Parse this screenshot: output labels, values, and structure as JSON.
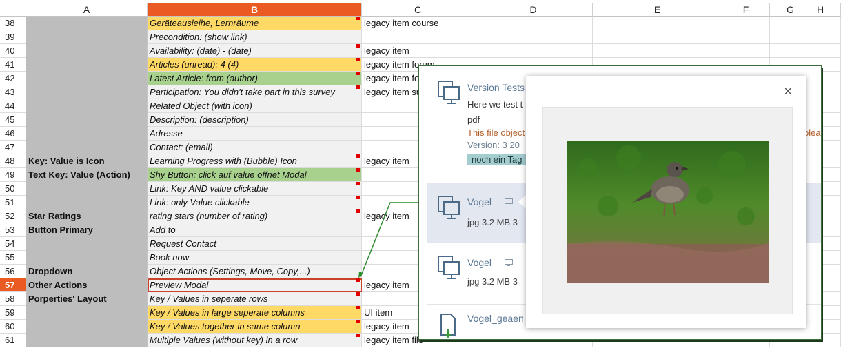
{
  "columns": [
    "A",
    "B",
    "C",
    "D",
    "E",
    "F",
    "G",
    "H"
  ],
  "rows": [
    {
      "n": "38",
      "a": "",
      "b": "Geräteausleihe, Lernräume",
      "b_fill": "yellow",
      "c": "legacy item course",
      "mark": true
    },
    {
      "n": "39",
      "a": "",
      "b": "Precondition: (show link)",
      "b_fill": "",
      "c": "",
      "mark": false
    },
    {
      "n": "40",
      "a": "",
      "b": "Availability: (date) - (date)",
      "b_fill": "",
      "c": "legacy item",
      "mark": true
    },
    {
      "n": "41",
      "a": "",
      "b": "Articles (unread): 4 (4)",
      "b_fill": "yellow",
      "c": "legacy item forum",
      "mark": true
    },
    {
      "n": "42",
      "a": "",
      "b": "Latest Article: from (author)",
      "b_fill": "green",
      "c": "legacy item fo",
      "mark": true
    },
    {
      "n": "43",
      "a": "",
      "b": "Participation: You didn't take part in this survey",
      "b_fill": "",
      "c": "legacy item su",
      "mark": true
    },
    {
      "n": "44",
      "a": "",
      "b": "Related Object (with icon)",
      "b_fill": "",
      "c": "",
      "mark": false
    },
    {
      "n": "45",
      "a": "",
      "b": "Description: (description)",
      "b_fill": "",
      "c": "",
      "mark": false
    },
    {
      "n": "46",
      "a": "",
      "b": "Adresse",
      "b_fill": "",
      "c": "",
      "mark": false
    },
    {
      "n": "47",
      "a": "",
      "b": "Contact: (email)",
      "b_fill": "",
      "c": "",
      "mark": false
    },
    {
      "n": "48",
      "a": "Key: Value is Icon",
      "b": "Learning Progress with (Bubble) Icon",
      "b_fill": "",
      "c": "legacy item",
      "mark": true
    },
    {
      "n": "49",
      "a": "Text Key: Value (Action)",
      "b": "Shy Button: click auf value öffnet Modal",
      "b_fill": "green",
      "c": "",
      "mark": true
    },
    {
      "n": "50",
      "a": "",
      "b": "Link: Key AND value clickable",
      "b_fill": "",
      "c": "",
      "mark": true
    },
    {
      "n": "51",
      "a": "",
      "b": "Link: only Value clickable",
      "b_fill": "",
      "c": "",
      "mark": true
    },
    {
      "n": "52",
      "a": "Star Ratings",
      "b": "rating stars (number of rating)",
      "b_fill": "",
      "c": "legacy item",
      "mark": true
    },
    {
      "n": "53",
      "a": "Button Primary",
      "b": "Add to",
      "b_fill": "",
      "c": "",
      "mark": false
    },
    {
      "n": "54",
      "a": "",
      "b": "Request Contact",
      "b_fill": "",
      "c": "",
      "mark": false
    },
    {
      "n": "55",
      "a": "",
      "b": "Book now",
      "b_fill": "",
      "c": "",
      "mark": false
    },
    {
      "n": "56",
      "a": "Dropdown",
      "b": "Object Actions (Settings, Move, Copy,...)",
      "b_fill": "",
      "c": "",
      "mark": false
    },
    {
      "n": "57",
      "a": "Other Actions",
      "b": "Preview Modal",
      "b_fill": "",
      "c": "legacy item",
      "mark": true,
      "selected": true
    },
    {
      "n": "58",
      "a": "Porperties' Layout",
      "b": "Key / Values in seperate rows",
      "b_fill": "",
      "c": "",
      "mark": true
    },
    {
      "n": "59",
      "a": "",
      "b": "Key / Values in large seperate columns",
      "b_fill": "yellow",
      "c": "UI item",
      "mark": true
    },
    {
      "n": "60",
      "a": "",
      "b": "Key / Values together in same column",
      "b_fill": "yellow",
      "c": "legacy item",
      "mark": true
    },
    {
      "n": "61",
      "a": "",
      "b": "Multiple Values (without key) in a row",
      "b_fill": "",
      "c": "legacy item file",
      "mark": true
    }
  ],
  "preview_list": {
    "item1": {
      "title": "Version Tests",
      "text": "Here we test t",
      "type": "pdf",
      "warning": "This file object",
      "warning_tail": "plea",
      "meta": "Version: 3   20",
      "tag": "noch ein Tag"
    },
    "item2": {
      "title": "Vogel",
      "meta": "jpg   3.2 MB   3"
    },
    "item3": {
      "title": "Vogel",
      "meta": "jpg   3.2 MB   3"
    },
    "item4": {
      "title": "Vogel_geaen"
    }
  },
  "modal": {
    "close_label": "×",
    "image": "bird-photo"
  },
  "colors": {
    "selected_header": "#ea5a23",
    "yellow": "#ffd966",
    "green": "#a9d18e",
    "col_a": "#bdbdbd",
    "tag": "#a4cdd0"
  }
}
